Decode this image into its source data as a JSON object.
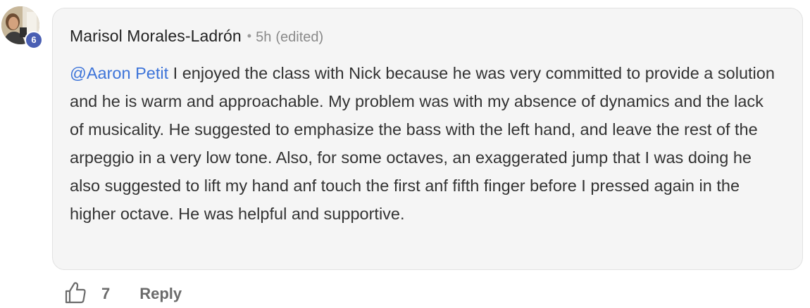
{
  "comment": {
    "author": "Marisol Morales-Ladrón",
    "separator": "•",
    "time": "5h",
    "edited": "(edited)",
    "level_badge": "6",
    "mention": "@Aaron Petit",
    "text": " I enjoyed the class with Nick because he was very committed to provide a solution and he is warm and approachable. My problem was with my absence of dynamics and the lack of musicality. He suggested to emphasize the bass with the left hand, and leave the rest of the arpeggio in a very low tone. Also, for some octaves, an exaggerated jump that I was doing he also suggested to lift my hand anf touch the first anf fifth finger before I pressed again in the higher octave. He was helpful and supportive."
  },
  "actions": {
    "like_icon": "thumbs-up-outline-icon",
    "like_count": "7",
    "reply_label": "Reply"
  },
  "colors": {
    "mention": "#3d74d9",
    "badge": "#4a5fb3",
    "bubble_bg": "#f5f5f5",
    "text": "#333333",
    "muted": "#8a8a8a"
  }
}
